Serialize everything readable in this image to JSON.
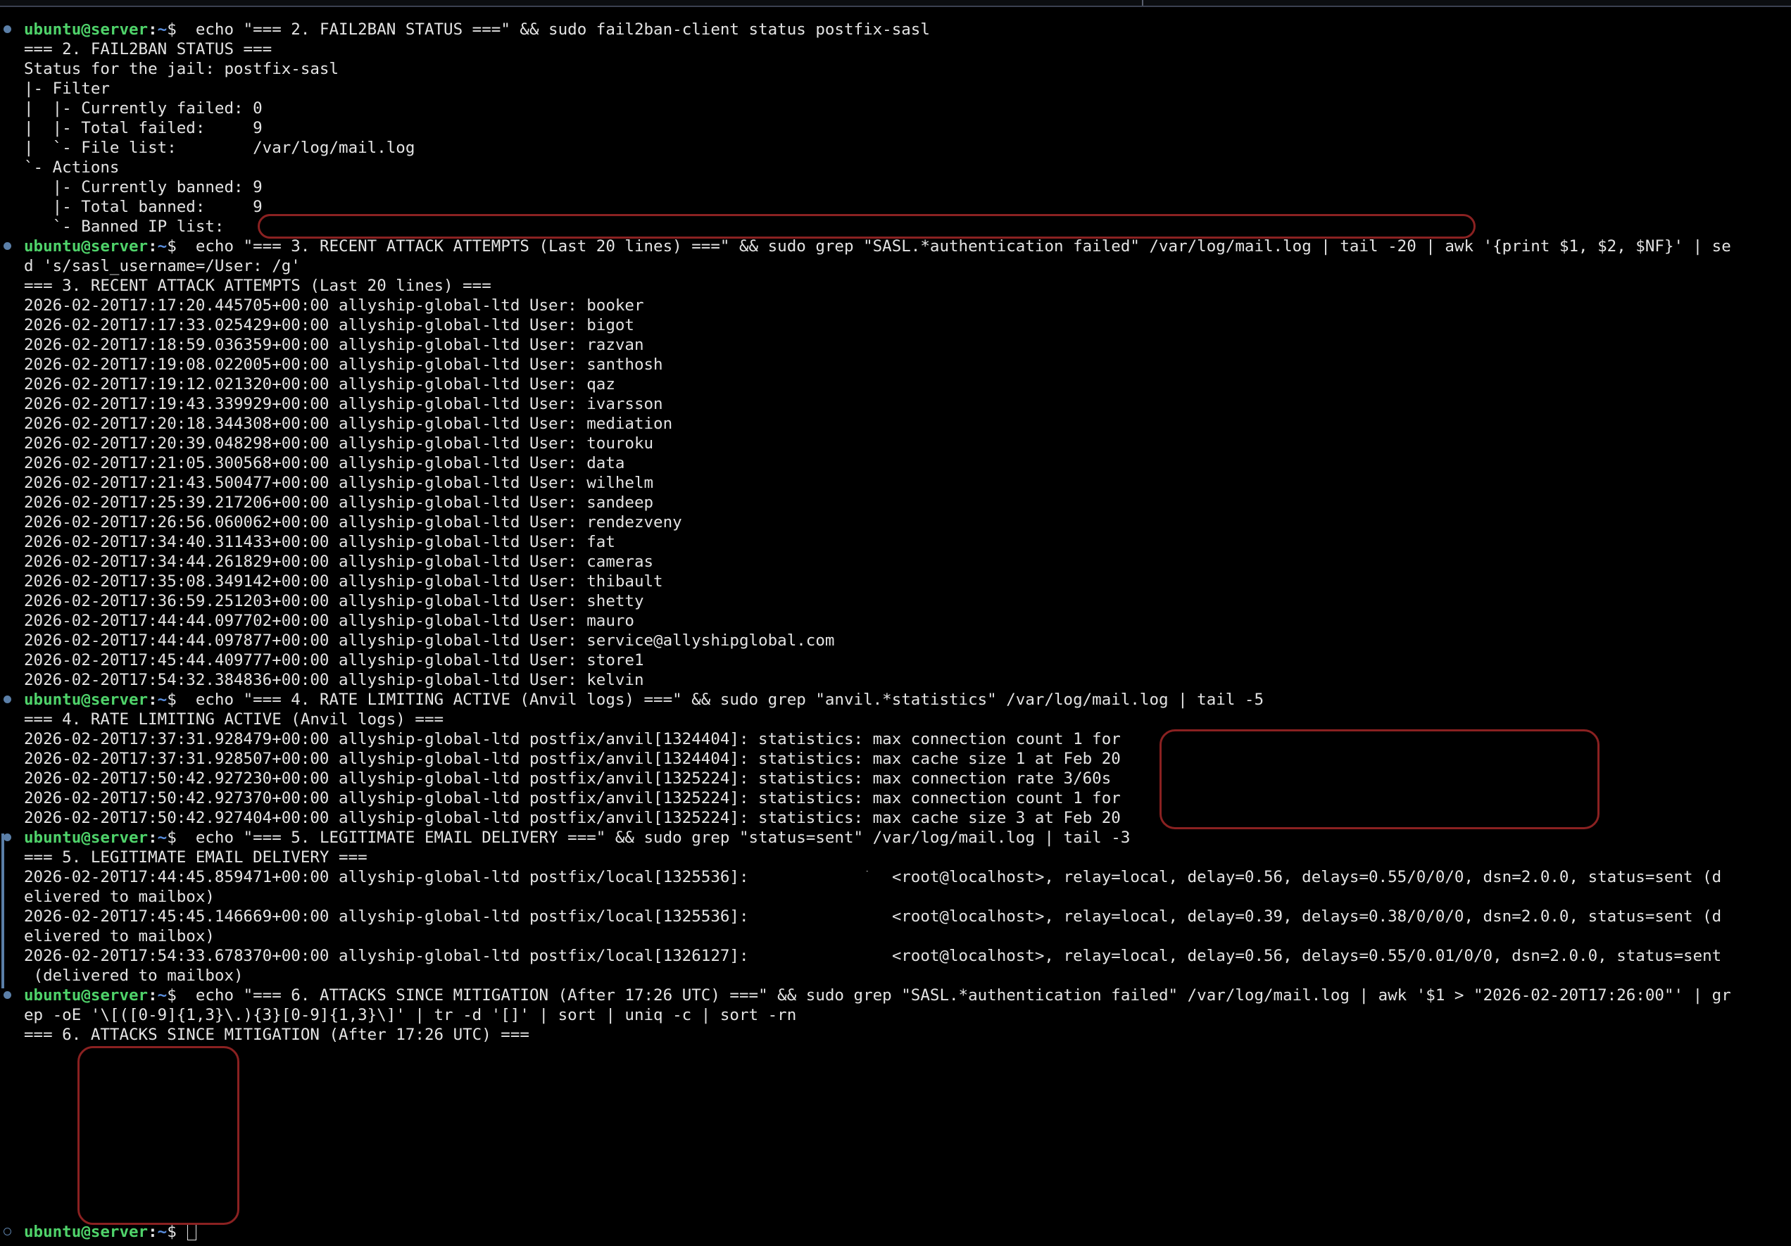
{
  "prompt": {
    "user_host": "ubuntu@server",
    "sep": ":",
    "path": "~",
    "sign": "$"
  },
  "lines": [
    {
      "type": "cmd",
      "text": "  echo \"=== 2. FAIL2BAN STATUS ===\" && sudo fail2ban-client status postfix-sasl"
    },
    {
      "type": "out",
      "text": "=== 2. FAIL2BAN STATUS ==="
    },
    {
      "type": "out",
      "text": "Status for the jail: postfix-sasl"
    },
    {
      "type": "out",
      "text": "|- Filter"
    },
    {
      "type": "out",
      "text": "|  |- Currently failed: 0"
    },
    {
      "type": "out",
      "text": "|  |- Total failed:     9"
    },
    {
      "type": "out",
      "text": "|  `- File list:        /var/log/mail.log"
    },
    {
      "type": "out",
      "text": "`- Actions"
    },
    {
      "type": "out",
      "text": "   |- Currently banned: 9"
    },
    {
      "type": "out",
      "text": "   |- Total banned:     9"
    },
    {
      "type": "out",
      "text": "   `- Banned IP list:"
    },
    {
      "type": "cmd",
      "text": "  echo \"=== 3. RECENT ATTACK ATTEMPTS (Last 20 lines) ===\" && sudo grep \"SASL.*authentication failed\" /var/log/mail.log | tail -20 | awk '{print $1, $2, $NF}' | se"
    },
    {
      "type": "out",
      "text": "d 's/sasl_username=/User: /g'"
    },
    {
      "type": "out",
      "text": "=== 3. RECENT ATTACK ATTEMPTS (Last 20 lines) ==="
    },
    {
      "type": "out",
      "text": "2026-02-20T17:17:20.445705+00:00 allyship-global-ltd User: booker"
    },
    {
      "type": "out",
      "text": "2026-02-20T17:17:33.025429+00:00 allyship-global-ltd User: bigot"
    },
    {
      "type": "out",
      "text": "2026-02-20T17:18:59.036359+00:00 allyship-global-ltd User: razvan"
    },
    {
      "type": "out",
      "text": "2026-02-20T17:19:08.022005+00:00 allyship-global-ltd User: santhosh"
    },
    {
      "type": "out",
      "text": "2026-02-20T17:19:12.021320+00:00 allyship-global-ltd User: qaz"
    },
    {
      "type": "out",
      "text": "2026-02-20T17:19:43.339929+00:00 allyship-global-ltd User: ivarsson"
    },
    {
      "type": "out",
      "text": "2026-02-20T17:20:18.344308+00:00 allyship-global-ltd User: mediation"
    },
    {
      "type": "out",
      "text": "2026-02-20T17:20:39.048298+00:00 allyship-global-ltd User: touroku"
    },
    {
      "type": "out",
      "text": "2026-02-20T17:21:05.300568+00:00 allyship-global-ltd User: data"
    },
    {
      "type": "out",
      "text": "2026-02-20T17:21:43.500477+00:00 allyship-global-ltd User: wilhelm"
    },
    {
      "type": "out",
      "text": "2026-02-20T17:25:39.217206+00:00 allyship-global-ltd User: sandeep"
    },
    {
      "type": "out",
      "text": "2026-02-20T17:26:56.060062+00:00 allyship-global-ltd User: rendezveny"
    },
    {
      "type": "out",
      "text": "2026-02-20T17:34:40.311433+00:00 allyship-global-ltd User: fat"
    },
    {
      "type": "out",
      "text": "2026-02-20T17:34:44.261829+00:00 allyship-global-ltd User: cameras"
    },
    {
      "type": "out",
      "text": "2026-02-20T17:35:08.349142+00:00 allyship-global-ltd User: thibault"
    },
    {
      "type": "out",
      "text": "2026-02-20T17:36:59.251203+00:00 allyship-global-ltd User: shetty"
    },
    {
      "type": "out",
      "text": "2026-02-20T17:44:44.097702+00:00 allyship-global-ltd User: mauro"
    },
    {
      "type": "out",
      "text": "2026-02-20T17:44:44.097877+00:00 allyship-global-ltd User: service@allyshipglobal.com"
    },
    {
      "type": "out",
      "text": "2026-02-20T17:45:44.409777+00:00 allyship-global-ltd User: store1"
    },
    {
      "type": "out",
      "text": "2026-02-20T17:54:32.384836+00:00 allyship-global-ltd User: kelvin"
    },
    {
      "type": "cmd",
      "text": "  echo \"=== 4. RATE LIMITING ACTIVE (Anvil logs) ===\" && sudo grep \"anvil.*statistics\" /var/log/mail.log | tail -5"
    },
    {
      "type": "out",
      "text": "=== 4. RATE LIMITING ACTIVE (Anvil logs) ==="
    },
    {
      "type": "out",
      "text": "2026-02-20T17:37:31.928479+00:00 allyship-global-ltd postfix/anvil[1324404]: statistics: max connection count 1 for"
    },
    {
      "type": "out",
      "text": "2026-02-20T17:37:31.928507+00:00 allyship-global-ltd postfix/anvil[1324404]: statistics: max cache size 1 at Feb 20"
    },
    {
      "type": "out",
      "text": "2026-02-20T17:50:42.927230+00:00 allyship-global-ltd postfix/anvil[1325224]: statistics: max connection rate 3/60s"
    },
    {
      "type": "out",
      "text": "2026-02-20T17:50:42.927370+00:00 allyship-global-ltd postfix/anvil[1325224]: statistics: max connection count 1 for"
    },
    {
      "type": "out",
      "text": "2026-02-20T17:50:42.927404+00:00 allyship-global-ltd postfix/anvil[1325224]: statistics: max cache size 3 at Feb 20"
    },
    {
      "type": "cmd",
      "text": "  echo \"=== 5. LEGITIMATE EMAIL DELIVERY ===\" && sudo grep \"status=sent\" /var/log/mail.log | tail -3"
    },
    {
      "type": "out",
      "text": "=== 5. LEGITIMATE EMAIL DELIVERY ==="
    },
    {
      "type": "out",
      "text": "2026-02-20T17:44:45.859471+00:00 allyship-global-ltd postfix/local[1325536]:            to=<root@localhost>, relay=local, delay=0.56, delays=0.55/0/0/0, dsn=2.0.0, status=sent (d"
    },
    {
      "type": "out",
      "text": "elivered to mailbox)"
    },
    {
      "type": "out",
      "text": "2026-02-20T17:45:45.146669+00:00 allyship-global-ltd postfix/local[1325536]:            to=<root@localhost>, relay=local, delay=0.39, delays=0.38/0/0/0, dsn=2.0.0, status=sent (d"
    },
    {
      "type": "out",
      "text": "elivered to mailbox)"
    },
    {
      "type": "out",
      "text": "2026-02-20T17:54:33.678370+00:00 allyship-global-ltd postfix/local[1326127]:            to=<root@localhost>, relay=local, delay=0.56, delays=0.55/0.01/0/0, dsn=2.0.0, status=sent"
    },
    {
      "type": "out",
      "text": " (delivered to mailbox)"
    },
    {
      "type": "cmd",
      "text": "  echo \"=== 6. ATTACKS SINCE MITIGATION (After 17:26 UTC) ===\" && sudo grep \"SASL.*authentication failed\" /var/log/mail.log | awk '$1 > \"2026-02-20T17:26:00\"' | gr"
    },
    {
      "type": "out",
      "text": "ep -oE '\\[([0-9]{1,3}\\.){3}[0-9]{1,3}\\]' | tr -d '[]' | sort | uniq -c | sort -rn"
    },
    {
      "type": "out",
      "text": "=== 6. ATTACKS SINCE MITIGATION (After 17:26 UTC) ==="
    },
    {
      "type": "out",
      "text": ""
    },
    {
      "type": "out",
      "text": ""
    },
    {
      "type": "out",
      "text": ""
    },
    {
      "type": "out",
      "text": ""
    },
    {
      "type": "out",
      "text": ""
    },
    {
      "type": "out",
      "text": ""
    },
    {
      "type": "out",
      "text": ""
    },
    {
      "type": "out",
      "text": ""
    },
    {
      "type": "out",
      "text": ""
    },
    {
      "type": "input",
      "text": " "
    }
  ]
}
